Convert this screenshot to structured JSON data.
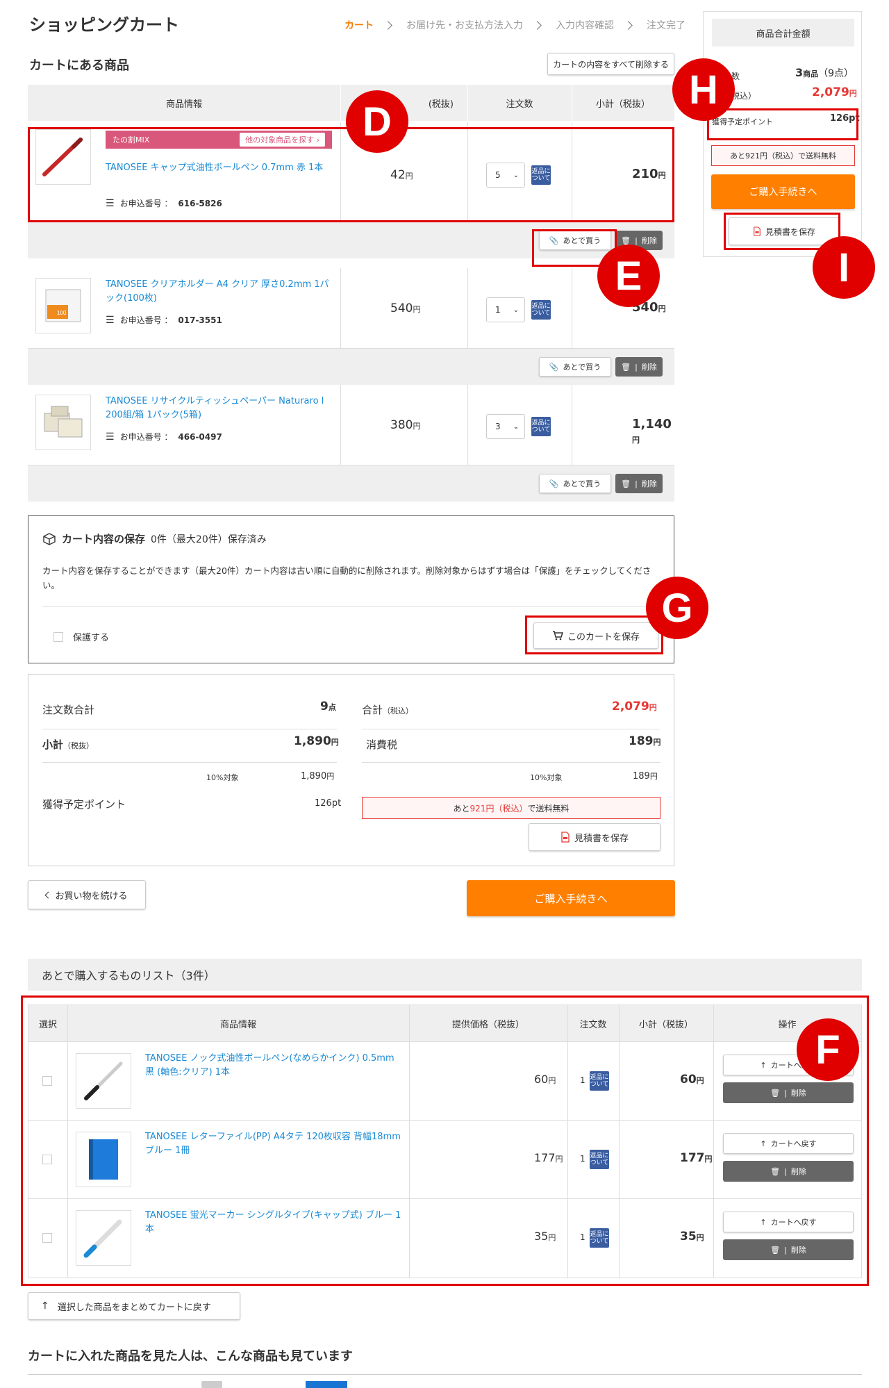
{
  "page": {
    "title": "ショッピングカート"
  },
  "steps": [
    "カート",
    "お届け先・お支払方法入力",
    "入力内容確認",
    "注文完了"
  ],
  "cart": {
    "heading": "カートにある商品",
    "clear_all": "カートの内容をすべて削除する",
    "columns": [
      "商品情報",
      "(税抜)",
      "注文数",
      "小計（税抜）"
    ],
    "items": [
      {
        "promo": "たの割MIX",
        "promo_link": "他の対象商品を探す",
        "name": "TANOSEE キャップ式油性ボールペン 0.7mm 赤 1本",
        "order_no_label": "お申込番号 ：",
        "order_no": "616-5826",
        "price": "42",
        "qty": "5",
        "subtotal": "210"
      },
      {
        "name": "TANOSEE クリアホルダー A4 クリア 厚さ0.2mm 1パック(100枚)",
        "order_no_label": "お申込番号 ：",
        "order_no": "017-3551",
        "price": "540",
        "qty": "1",
        "subtotal": "540"
      },
      {
        "name": "TANOSEE リサイクルティッシュペーパー Naturaro l 200組/箱 1パック(5箱)",
        "order_no_label": "お申込番号 ：",
        "order_no": "466-0497",
        "price": "380",
        "qty": "3",
        "subtotal": "1,140"
      }
    ],
    "later_label": "あとで買う",
    "delete_label": "削除",
    "yen": "円",
    "henpin": "返品について"
  },
  "save": {
    "title": "カート内容の保存",
    "status": "0件（最大20件）保存済み",
    "desc": "カート内容を保存することができます（最大20件）カート内容は古い順に自動的に削除されます。削除対象からはずす場合は「保護」をチェックしてください。",
    "protect": "保護する",
    "save_btn": "このカートを保存"
  },
  "summary": {
    "qty_label": "注文数合計",
    "qty_value": "9",
    "qty_unit": "点",
    "total_label": "合計",
    "total_tax": "（税込）",
    "total_value": "2,079",
    "subtotal_label": "小計",
    "subtotal_tax": "（税抜）",
    "subtotal_value": "1,890",
    "tax_label": "消費税",
    "tax_value": "189",
    "rate_label": "10%対象",
    "rate_sub": "1,890",
    "rate_tax": "189",
    "points_label": "獲得予定ポイント",
    "points_value": "126pt",
    "free_ship_pre": "あと",
    "free_ship_amt": "921円（税込）",
    "free_ship_post": "で送料無料",
    "estimate": "見積書を保存"
  },
  "continue_btn": "お買い物を続ける",
  "checkout_btn": "ご購入手続きへ",
  "sidebar": {
    "title": "商品合計金額",
    "count_label": "数",
    "count_value": "3",
    "count_unit": "商品",
    "count_pts": "（9点）",
    "tax_label": "税込）",
    "total": "2,079",
    "points_label": "獲得予定ポイント",
    "points": "126pt",
    "free_ship": "あと921円（税込）で送料無料",
    "checkout": "ご購入手続きへ",
    "estimate": "見積書を保存"
  },
  "later": {
    "heading": "あとで購入するものリスト（3件）",
    "columns": [
      "選択",
      "商品情報",
      "提供価格（税抜）",
      "注文数",
      "小計（税抜）",
      "操作"
    ],
    "items": [
      {
        "name": "TANOSEE ノック式油性ボールペン(なめらかインク) 0.5mm 黒 (軸色:クリア) 1本",
        "price": "60",
        "qty": "1",
        "subtotal": "60"
      },
      {
        "name": "TANOSEE レターファイル(PP) A4タテ 120枚収容 背幅18mm ブルー 1冊",
        "price": "177",
        "qty": "1",
        "subtotal": "177"
      },
      {
        "name": "TANOSEE 蛍光マーカー シングルタイプ(キャップ式) ブルー 1本",
        "price": "35",
        "qty": "1",
        "subtotal": "35"
      }
    ],
    "back_btn": "カートへ戻す",
    "delete_btn": "削除",
    "bulk_back": "選択した商品をまとめてカートに戻す"
  },
  "reco_heading": "カートに入れた商品を見た人は、こんな商品も見ています",
  "markers": [
    "D",
    "E",
    "F",
    "G",
    "H",
    "I"
  ]
}
